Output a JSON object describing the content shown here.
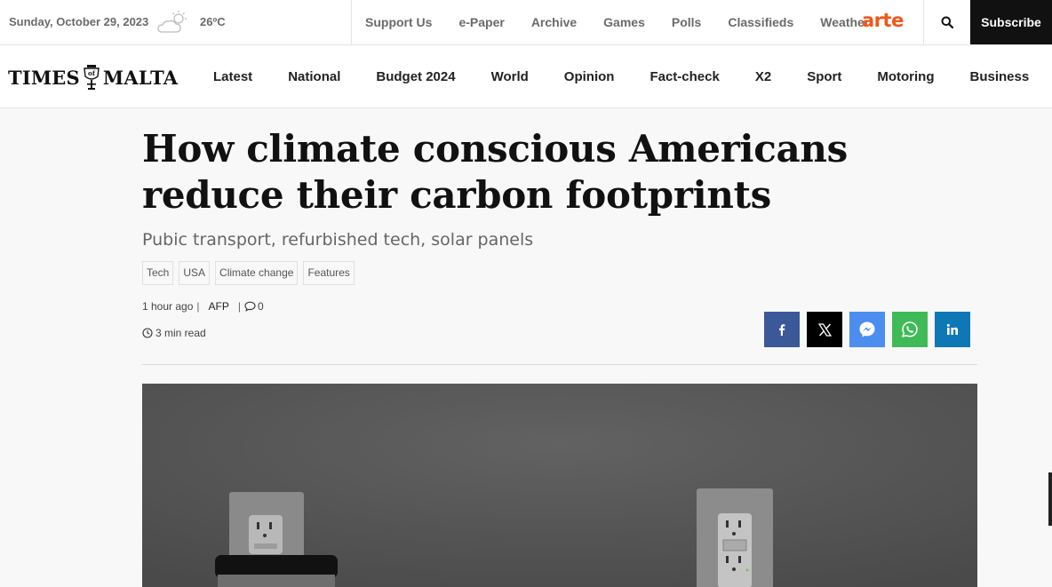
{
  "topbar": {
    "date": "Sunday, October 29, 2023",
    "weather_icon": "partly-cloudy-icon",
    "temperature": "26ºC",
    "links": [
      "Support Us",
      "e-Paper",
      "Archive",
      "Games",
      "Polls",
      "Classifieds",
      "Weather"
    ],
    "partner_logo": "arte",
    "search_icon": "search-icon",
    "subscribe_label": "Subscribe"
  },
  "brand": {
    "logo_left": "TIMES",
    "logo_right": "MALTA",
    "logo_crest": "of"
  },
  "nav": {
    "items": [
      "Latest",
      "National",
      "Budget 2024",
      "World",
      "Opinion",
      "Fact-check",
      "X2",
      "Sport",
      "Motoring",
      "Business"
    ]
  },
  "article": {
    "headline": "How climate conscious Americans reduce their carbon footprints",
    "subhead": "Pubic transport, refurbished tech, solar panels",
    "tags": [
      "Tech",
      "USA",
      "Climate change",
      "Features"
    ],
    "published": "1 hour ago",
    "author": "AFP",
    "comment_count": "0",
    "read_time": "3 min read"
  },
  "share": {
    "buttons": [
      {
        "icon": "facebook-icon",
        "color": "#3b5998"
      },
      {
        "icon": "x-icon",
        "color": "#000000"
      },
      {
        "icon": "messenger-icon",
        "color": "#4b8ef0"
      },
      {
        "icon": "whatsapp-icon",
        "color": "#3ebb57"
      },
      {
        "icon": "linkedin-icon",
        "color": "#0e78b6"
      }
    ]
  },
  "colors": {
    "accent_partner": "#f0561a",
    "subscribe_bg": "#111111",
    "page_bg": "#f8f8f8"
  }
}
